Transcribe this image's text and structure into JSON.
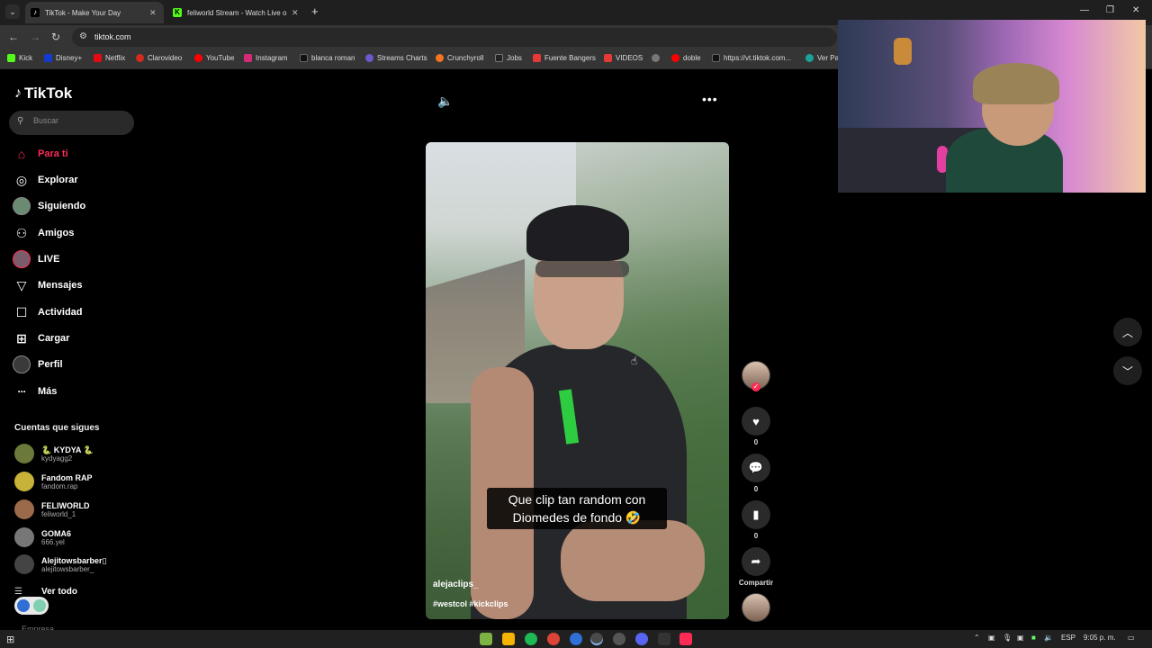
{
  "browser": {
    "tabs": [
      {
        "title": "TikTok - Make Your Day",
        "active": true
      },
      {
        "title": "feliworld Stream - Watch Live o",
        "active": false
      }
    ],
    "url": "tiktok.com",
    "bookmarks": [
      {
        "label": "Kick",
        "color": "#53fc18"
      },
      {
        "label": "Disney+",
        "color": "#113ccf"
      },
      {
        "label": "Netflix",
        "color": "#e50914"
      },
      {
        "label": "Clarovideo",
        "color": "#d52b1e"
      },
      {
        "label": "YouTube",
        "color": "#ff0000"
      },
      {
        "label": "Instagram",
        "color": "#d62976"
      },
      {
        "label": "blanca roman",
        "color": "#111111"
      },
      {
        "label": "Streams Charts",
        "color": "#6a5acd"
      },
      {
        "label": "Crunchyroll",
        "color": "#f47521"
      },
      {
        "label": "Jobs",
        "color": "#222222"
      },
      {
        "label": "Fuente Bangers",
        "color": "#e53935"
      },
      {
        "label": "VIDEOS",
        "color": "#e53935"
      },
      {
        "label": "",
        "color": "#777777"
      },
      {
        "label": "doble",
        "color": "#ff0000"
      },
      {
        "label": "https://vt.tiktok.com...",
        "color": "#111111"
      },
      {
        "label": "Ver Pa",
        "color": "#1aa39a"
      }
    ]
  },
  "tiktok": {
    "logo": "TikTok",
    "search_placeholder": "Buscar",
    "nav": [
      {
        "label": "Para ti",
        "icon": "home-icon",
        "active": true
      },
      {
        "label": "Explorar",
        "icon": "compass-icon",
        "active": false
      },
      {
        "label": "Siguiendo",
        "icon": "following-avatar-icon",
        "active": false
      },
      {
        "label": "Amigos",
        "icon": "friends-icon",
        "active": false
      },
      {
        "label": "LIVE",
        "icon": "live-avatar-icon",
        "active": false
      },
      {
        "label": "Mensajes",
        "icon": "send-icon",
        "active": false
      },
      {
        "label": "Actividad",
        "icon": "activity-icon",
        "active": false
      },
      {
        "label": "Cargar",
        "icon": "upload-icon",
        "active": false
      },
      {
        "label": "Perfil",
        "icon": "profile-avatar-icon",
        "active": false
      },
      {
        "label": "Más",
        "icon": "more-dots-icon",
        "active": false
      }
    ],
    "following_title": "Cuentas que sigues",
    "following": [
      {
        "name": "🐍 KYDYA 🐍",
        "username": "kydyagg2",
        "color": "#6b7a3a"
      },
      {
        "name": "Fandom RAP",
        "username": "fandom.rap",
        "color": "#c7b23a"
      },
      {
        "name": "FELIWORLD",
        "username": "feliworld_1",
        "color": "#9a6a4a"
      },
      {
        "name": "GOMA6",
        "username": "666.yel",
        "color": "#777777"
      },
      {
        "name": "Alejitowsbarber▯",
        "username": "alejitowsbarber_",
        "color": "#444444"
      }
    ],
    "see_all": "Ver todo",
    "empresa": "Empresa",
    "video": {
      "caption_line1": "Que clip tan random con",
      "caption_line2": "Diomedes de fondo 🤣",
      "username": "alejaclips_",
      "hashtags": "#westcol #kickclips"
    },
    "actions": {
      "likes": "0",
      "comments": "0",
      "saves": "0",
      "share_label": "Compartir"
    }
  },
  "taskbar": {
    "language": "ESP",
    "time": "9:05 p. m."
  }
}
